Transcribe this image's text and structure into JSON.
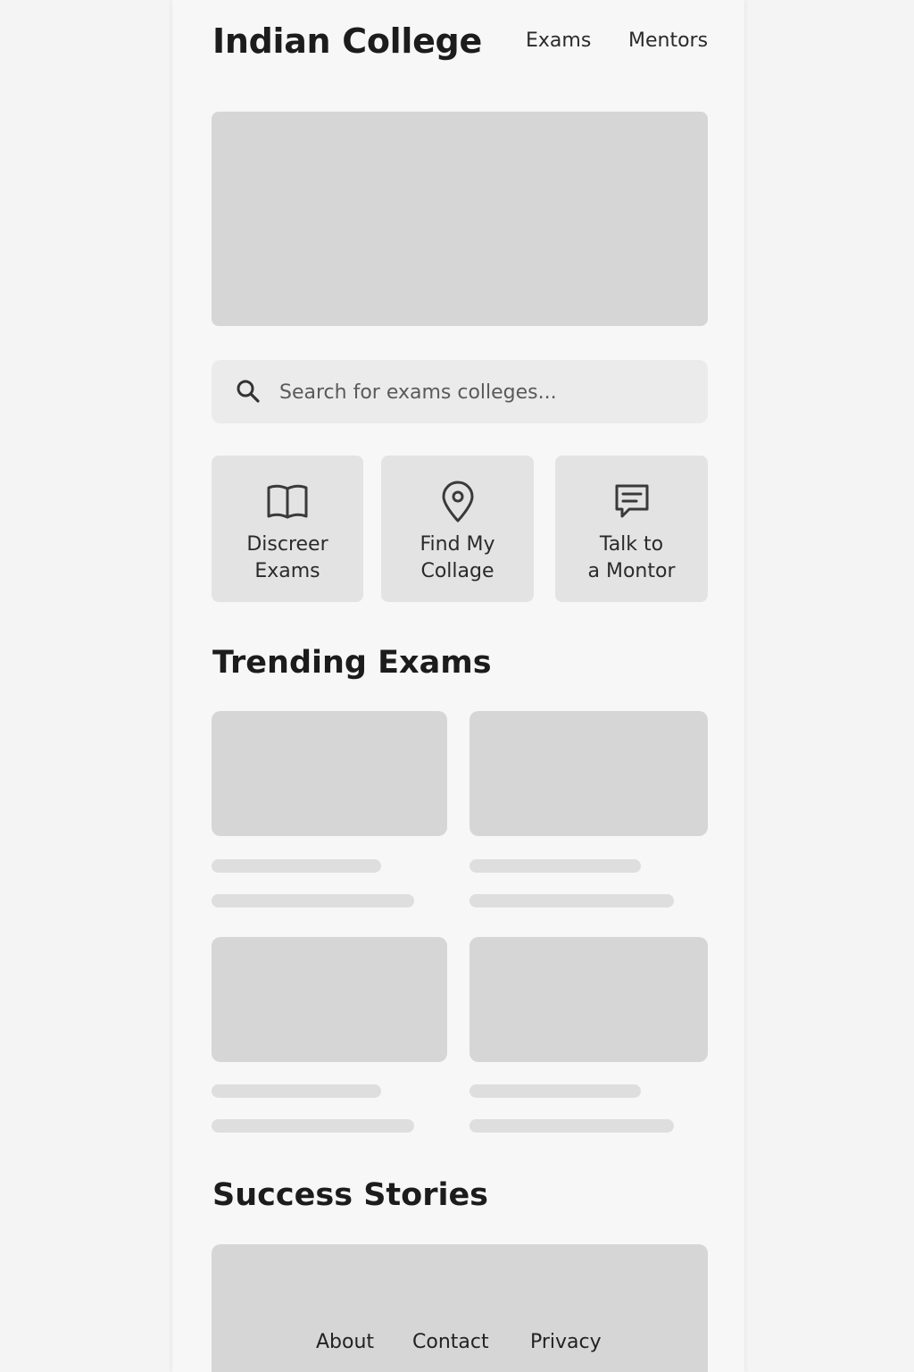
{
  "header": {
    "brand": "Indian College",
    "nav": [
      "Exams",
      "Mentors"
    ]
  },
  "search": {
    "placeholder": "Search for exams colleges...",
    "icon": "search-icon"
  },
  "actions": [
    {
      "icon": "open-book-icon",
      "line1": "Discreer",
      "line2": "Exams"
    },
    {
      "icon": "location-pin-icon",
      "line1": "Find My",
      "line2": "Collage"
    },
    {
      "icon": "chat-icon",
      "line1": "Talk to",
      "line2": "a Montor"
    }
  ],
  "sections": {
    "trending": "Trending Exams",
    "stories": "Success Stories"
  },
  "footer": {
    "links": [
      "About",
      "Contact",
      "Privacy"
    ]
  },
  "colors": {
    "background": "#f4f4f4",
    "panel": "#f7f7f7",
    "placeholder_block": "#d6d6d6",
    "tile": "#e3e3e3",
    "text": "#1c1c1c"
  }
}
